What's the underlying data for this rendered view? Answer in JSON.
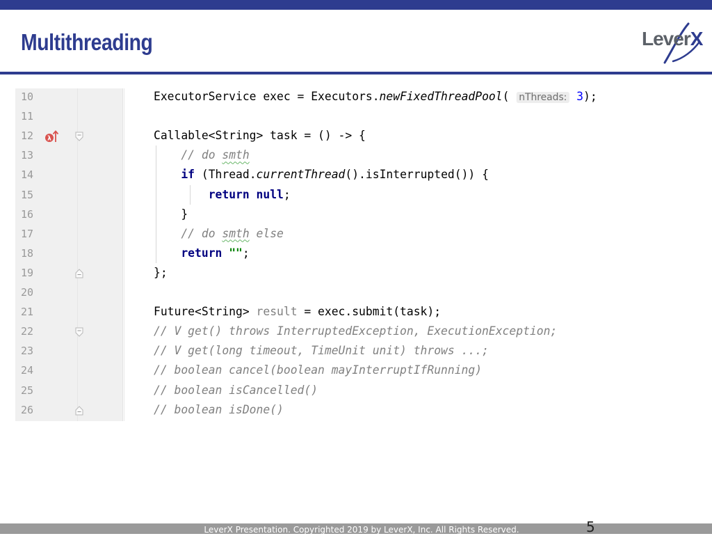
{
  "slide": {
    "title": "Multithreading",
    "logo": {
      "text_main": "Lever",
      "text_accent": "X"
    },
    "footer": "LeverX Presentation. Copyrighted 2019 by LeverX, Inc. All Rights Reserved.",
    "page_number": "5"
  },
  "editor": {
    "lines": [
      {
        "n": "10",
        "parts": [
          {
            "t": "ExecutorService exec = Executors."
          },
          {
            "t": "newFixedThreadPool",
            "c": "it"
          },
          {
            "t": "( "
          },
          {
            "t": "nThreads:",
            "c": "hint"
          },
          {
            "t": " "
          },
          {
            "t": "3",
            "c": "num"
          },
          {
            "t": ");"
          }
        ]
      },
      {
        "n": "11",
        "parts": []
      },
      {
        "n": "12",
        "parts": [
          {
            "t": "Callable<String> task = () -> {"
          }
        ]
      },
      {
        "n": "13",
        "parts": [
          {
            "t": "    "
          },
          {
            "t": "// do ",
            "c": "cm"
          },
          {
            "t": "smth",
            "c": "cm squiggle"
          }
        ]
      },
      {
        "n": "14",
        "parts": [
          {
            "t": "    "
          },
          {
            "t": "if",
            "c": "kw"
          },
          {
            "t": " (Thread."
          },
          {
            "t": "currentThread",
            "c": "it"
          },
          {
            "t": "().isInterrupted()) {"
          }
        ]
      },
      {
        "n": "15",
        "parts": [
          {
            "t": "        "
          },
          {
            "t": "return null",
            "c": "kw"
          },
          {
            "t": ";"
          }
        ]
      },
      {
        "n": "16",
        "parts": [
          {
            "t": "    }"
          }
        ]
      },
      {
        "n": "17",
        "parts": [
          {
            "t": "    "
          },
          {
            "t": "// do ",
            "c": "cm"
          },
          {
            "t": "smth",
            "c": "cm squiggle"
          },
          {
            "t": " else",
            "c": "cm"
          }
        ]
      },
      {
        "n": "18",
        "parts": [
          {
            "t": "    "
          },
          {
            "t": "return",
            "c": "kw"
          },
          {
            "t": " "
          },
          {
            "t": "\"\"",
            "c": "str"
          },
          {
            "t": ";"
          }
        ]
      },
      {
        "n": "19",
        "parts": [
          {
            "t": "};"
          }
        ]
      },
      {
        "n": "20",
        "parts": []
      },
      {
        "n": "21",
        "parts": [
          {
            "t": "Future<String> "
          },
          {
            "t": "result",
            "c": "cm-plain"
          },
          {
            "t": " = exec.submit(task);"
          }
        ]
      },
      {
        "n": "22",
        "parts": [
          {
            "t": "// V get() throws InterruptedException, ExecutionException;",
            "c": "cm"
          }
        ]
      },
      {
        "n": "23",
        "parts": [
          {
            "t": "// V get(long timeout, TimeUnit unit) throws ...;",
            "c": "cm"
          }
        ]
      },
      {
        "n": "24",
        "parts": [
          {
            "t": "// boolean cancel(boolean mayInterruptIfRunning)",
            "c": "cm"
          }
        ]
      },
      {
        "n": "25",
        "parts": [
          {
            "t": "// boolean isCancelled()",
            "c": "cm"
          }
        ]
      },
      {
        "n": "26",
        "parts": [
          {
            "t": "// boolean isDone()",
            "c": "cm"
          }
        ]
      }
    ],
    "gutter_icons": {
      "line_12": "lambda-implements-icon"
    },
    "fold_markers": {
      "line_12": "fold-start-icon",
      "line_19": "fold-end-icon",
      "line_22": "fold-start-icon",
      "line_26": "fold-end-icon"
    }
  }
}
